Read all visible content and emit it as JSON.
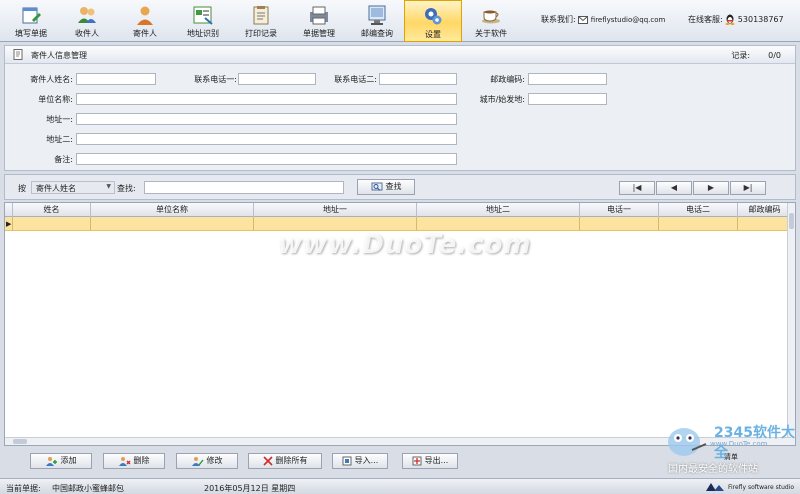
{
  "toolbar": {
    "items": [
      {
        "label": "填写单据",
        "icon": "edit-form-icon"
      },
      {
        "label": "收件人",
        "icon": "recipients-icon"
      },
      {
        "label": "寄件人",
        "icon": "sender-icon"
      },
      {
        "label": "地址识别",
        "icon": "address-recognition-icon"
      },
      {
        "label": "打印记录",
        "icon": "print-records-icon"
      },
      {
        "label": "单据管理",
        "icon": "document-management-icon"
      },
      {
        "label": "邮编查询",
        "icon": "postcode-query-icon"
      },
      {
        "label": "设置",
        "icon": "settings-gear-icon"
      },
      {
        "label": "关于软件",
        "icon": "about-cup-icon"
      }
    ],
    "active_index": 7,
    "contact_label": "联系我们:",
    "contact_email": "fireflystudio@qq.com",
    "support_label": "在线客服:",
    "support_qq": "530138767"
  },
  "panel": {
    "title": "寄件人信息管理",
    "records_label": "记录:",
    "records_value": "0/0",
    "fields": {
      "sender_name": "寄件人姓名:",
      "phone1": "联系电话一:",
      "phone2": "联系电话二:",
      "postcode": "邮政编码:",
      "company": "单位名称:",
      "city": "城市/始发地:",
      "address1": "地址一:",
      "address2": "地址二:",
      "remark": "备注:"
    }
  },
  "search": {
    "by_label": "按",
    "field_selected": "寄件人姓名",
    "find_label": "查找:",
    "find_button": "查找",
    "nav": [
      "|◀",
      "◀",
      "▶",
      "▶|"
    ]
  },
  "grid": {
    "columns": [
      "姓名",
      "单位名称",
      "地址一",
      "地址二",
      "电话一",
      "电话二",
      "邮政编码"
    ]
  },
  "actions": {
    "add": "添加",
    "delete": "删除",
    "edit": "修改",
    "delete_all": "删除所有",
    "import": "导入...",
    "export": "导出..."
  },
  "status": {
    "current_label": "当前单据:",
    "current_value": "中国邮政小蜜蜂邮包",
    "date": "2016年05月12日 星期四",
    "brand": "Firefly software studio"
  },
  "watermarks": {
    "duote": "www.DuoTe.com",
    "badge_main": "2345软件大全",
    "badge_url": "www.DuoTe.com",
    "badge_slogan": "国内最安全的软件站",
    "badge_extra": "清单"
  }
}
